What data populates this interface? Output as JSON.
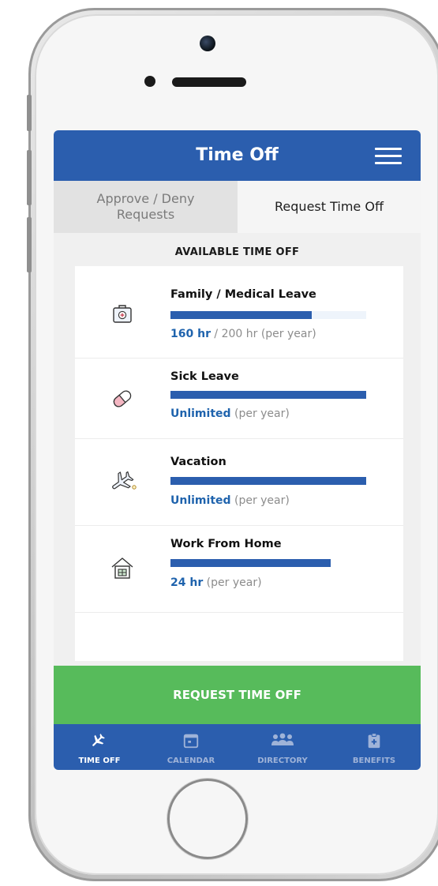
{
  "app": {
    "title": "Time Off"
  },
  "tabs": [
    {
      "label": "Approve / Deny Requests",
      "active": false
    },
    {
      "label": "Request Time Off",
      "active": true
    }
  ],
  "section_title": "AVAILABLE TIME OFF",
  "leave_types": [
    {
      "name": "Family / Medical Leave",
      "icon": "medical-kit-icon",
      "amount_strong": "160 hr",
      "amount_rest": " / 200 hr (per year)",
      "fill_fraction": 0.72
    },
    {
      "name": "Sick Leave",
      "icon": "pill-icon",
      "amount_strong": "Unlimited",
      "amount_rest": " (per year)",
      "fill_fraction": 1.0
    },
    {
      "name": "Vacation",
      "icon": "airplane-icon",
      "amount_strong": "Unlimited",
      "amount_rest": " (per year)",
      "fill_fraction": 1.0
    },
    {
      "name": "Work From Home",
      "icon": "house-icon",
      "amount_strong": "24 hr",
      "amount_rest": " (per year)",
      "fill_fraction": 0.82
    }
  ],
  "cta_label": "REQUEST TIME OFF",
  "nav": [
    {
      "label": "TIME OFF",
      "icon": "airplane-icon",
      "active": true
    },
    {
      "label": "CALENDAR",
      "icon": "calendar-icon",
      "active": false
    },
    {
      "label": "DIRECTORY",
      "icon": "people-icon",
      "active": false
    },
    {
      "label": "BENEFITS",
      "icon": "clipboard-plus-icon",
      "active": false
    }
  ],
  "colors": {
    "primary": "#2b5eae",
    "accent": "#1f63ad",
    "cta": "#57bb5b"
  }
}
